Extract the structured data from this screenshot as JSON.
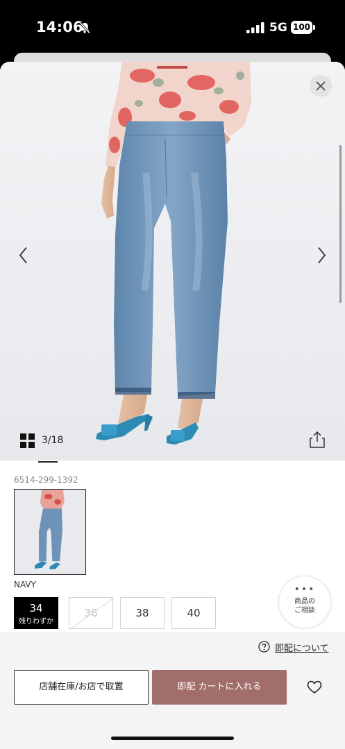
{
  "status_bar": {
    "time": "14:06",
    "network": "5G",
    "battery": "100",
    "icons": [
      "bell-slash-icon",
      "signal-icon",
      "battery-icon"
    ]
  },
  "gallery": {
    "page_counter": "3/18",
    "icons": [
      "close-icon",
      "chevron-left-icon",
      "chevron-right-icon",
      "grid-icon",
      "share-icon"
    ]
  },
  "product": {
    "code": "6514-299-1392",
    "color_name": "NAVY",
    "sizes": [
      {
        "label": "34",
        "note": "残りわずか",
        "state": "selected"
      },
      {
        "label": "36",
        "note": "",
        "state": "soldout"
      },
      {
        "label": "38",
        "note": "",
        "state": "available"
      },
      {
        "label": "40",
        "note": "",
        "state": "available"
      }
    ]
  },
  "consult_button": {
    "dots": "•••",
    "line1": "商品の",
    "line2": "ご相談"
  },
  "actions": {
    "delivery_link": "即配について",
    "store_button": "店舗在庫/お店で取置",
    "cart_button": "即配 カートに入れる",
    "favorite_icon": "heart-icon"
  },
  "colors": {
    "cart_button": "#a26e6b",
    "selected_size": "#000000",
    "background": "#ffffff"
  }
}
